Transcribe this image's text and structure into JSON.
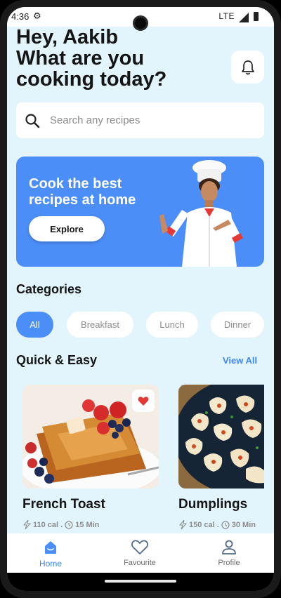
{
  "status_bar": {
    "time": "4:36",
    "network": "LTE"
  },
  "header": {
    "greeting_line1": "Hey, Aakib",
    "greeting_line2": "What are you",
    "greeting_line3": "cooking today?"
  },
  "search": {
    "placeholder": "Search any recipes"
  },
  "banner": {
    "title": "Cook the best recipes at home",
    "button_label": "Explore"
  },
  "categories": {
    "title": "Categories",
    "items": [
      {
        "label": "All",
        "active": true
      },
      {
        "label": "Breakfast",
        "active": false
      },
      {
        "label": "Lunch",
        "active": false
      },
      {
        "label": "Dinner",
        "active": false
      }
    ]
  },
  "quick_easy": {
    "title": "Quick & Easy",
    "view_all_label": "View All",
    "recipes": [
      {
        "name": "French Toast",
        "calories": "110 cal",
        "time": "15 Min",
        "favourite": true
      },
      {
        "name": "Dumplings",
        "calories": "150 cal",
        "time": "30 Min",
        "favourite": false
      }
    ],
    "meta_separator": "."
  },
  "bottom_nav": {
    "items": [
      {
        "label": "Home",
        "icon": "home-icon",
        "active": true
      },
      {
        "label": "Favourite",
        "icon": "heart-outline-icon",
        "active": false
      },
      {
        "label": "Profile",
        "icon": "person-icon",
        "active": false
      }
    ]
  },
  "colors": {
    "background": "#e2f5fd",
    "accent": "#4c8ef7",
    "favourite": "#e53935"
  }
}
